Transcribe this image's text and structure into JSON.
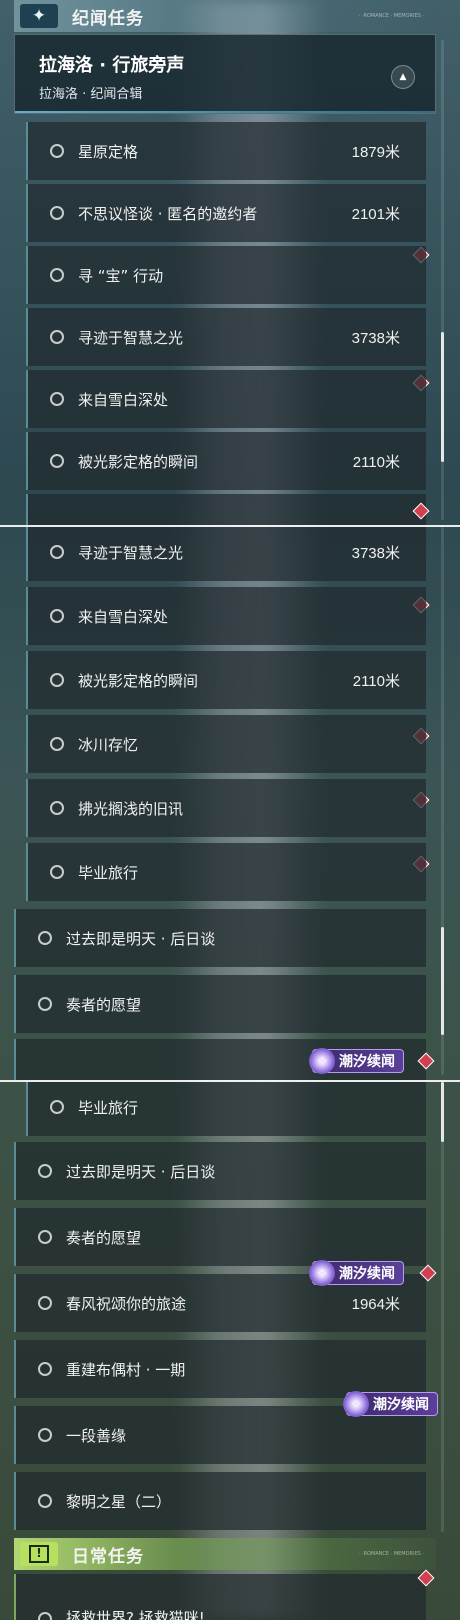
{
  "story_section": {
    "title": "纪闻任务",
    "icon": "compass-star-icon",
    "tiny_text": "· ·ROMANCE · MEMORIES ·"
  },
  "group": {
    "title": "拉海洛 · 行旅旁声",
    "subtitle": "拉海洛 · 纪闻合辑",
    "collapse_icon": "triangle-up-icon"
  },
  "panel1": [
    {
      "name": "星原定格",
      "dist": "1879米",
      "marker": false
    },
    {
      "name": "不思议怪谈 · 匿名的邀约者",
      "dist": "2101米",
      "marker": true
    },
    {
      "name": "寻 “宝” 行动",
      "dist": "",
      "marker": false
    },
    {
      "name": "寻迹于智慧之光",
      "dist": "3738米",
      "marker": true
    },
    {
      "name": "来自雪白深处",
      "dist": "",
      "marker": false
    },
    {
      "name": "被光影定格的瞬间",
      "dist": "2110米",
      "marker": true
    }
  ],
  "panel2": [
    {
      "name": "寻迹于智慧之光",
      "dist": "3738米"
    },
    {
      "name": "来自雪白深处",
      "dist": ""
    },
    {
      "name": "被光影定格的瞬间",
      "dist": "2110米"
    },
    {
      "name": "冰川存忆",
      "dist": ""
    },
    {
      "name": "拂光搁浅的旧讯",
      "dist": ""
    },
    {
      "name": "毕业旅行",
      "dist": ""
    },
    {
      "name": "过去即是明天 · 后日谈",
      "dist": ""
    },
    {
      "name": "奏者的愿望",
      "dist": ""
    }
  ],
  "panel3": [
    {
      "name": "毕业旅行",
      "dist": ""
    },
    {
      "name": "过去即是明天 · 后日谈",
      "dist": ""
    },
    {
      "name": "奏者的愿望",
      "dist": ""
    },
    {
      "name": "春风祝颂你的旅途",
      "dist": "1964米"
    },
    {
      "name": "重建布偶村 · 一期",
      "dist": ""
    },
    {
      "name": "一段善缘",
      "dist": ""
    },
    {
      "name": "黎明之星（二）",
      "dist": ""
    },
    {
      "name": "拯救世界? 拯救猫咪!",
      "dist": ""
    }
  ],
  "tide_badge": {
    "label": "潮汐续闻",
    "icon": "tide-sparkle-icon"
  },
  "daily_section": {
    "title": "日常任务",
    "icon": "exclamation-box-icon",
    "tiny_text": "· ·ROMANCE · MEMORIES ·"
  },
  "colors": {
    "marker": "#d04050",
    "tide_badge": "#5b3f9a",
    "daily_accent": "#b8e060"
  }
}
